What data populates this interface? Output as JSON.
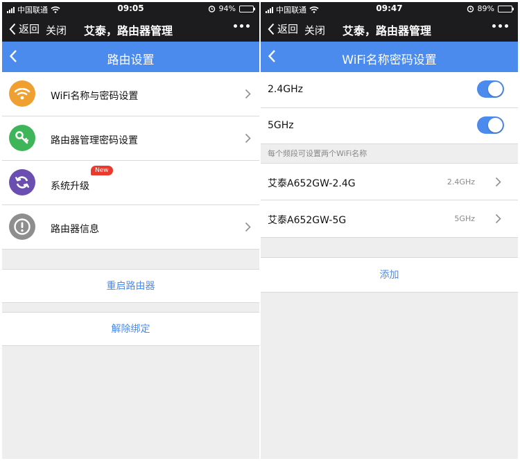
{
  "screens": [
    {
      "status": {
        "carrier": "中国联通",
        "time": "09:05",
        "battery": "94%",
        "battery_level": 0.94
      },
      "wechat": {
        "back": "返回",
        "close": "关闭",
        "title": "艾泰，路由器管理"
      },
      "header": {
        "title": "路由设置"
      },
      "menu": [
        {
          "label": "WiFi名称与密码设置",
          "icon": "wifi-icon",
          "color": "#f0a030"
        },
        {
          "label": "路由器管理密码设置",
          "icon": "key-icon",
          "color": "#3fb55a"
        },
        {
          "label": "系统升级",
          "icon": "refresh-icon",
          "color": "#6a4fb0",
          "badge": "New"
        },
        {
          "label": "路由器信息",
          "icon": "info-icon",
          "color": "#8e8e8e"
        }
      ],
      "actions": {
        "restart": "重启路由器",
        "unbind": "解除绑定"
      }
    },
    {
      "status": {
        "carrier": "中国联通",
        "time": "09:47",
        "battery": "89%",
        "battery_level": 0.89
      },
      "wechat": {
        "back": "返回",
        "close": "关闭",
        "title": "艾泰，路由器管理"
      },
      "header": {
        "title": "WiFi名称密码设置"
      },
      "bands": [
        {
          "label": "2.4GHz",
          "enabled": true
        },
        {
          "label": "5GHz",
          "enabled": true
        }
      ],
      "hint": "每个频段可设置两个WiFi名称",
      "ssids": [
        {
          "name": "艾泰A652GW-2.4G",
          "band": "2.4GHz"
        },
        {
          "name": "艾泰A652GW-5G",
          "band": "5GHz"
        }
      ],
      "actions": {
        "add": "添加"
      }
    }
  ],
  "colors": {
    "accent": "#4b8bee",
    "navbar": "#1c1c1e",
    "badge": "#ea3a2e"
  }
}
